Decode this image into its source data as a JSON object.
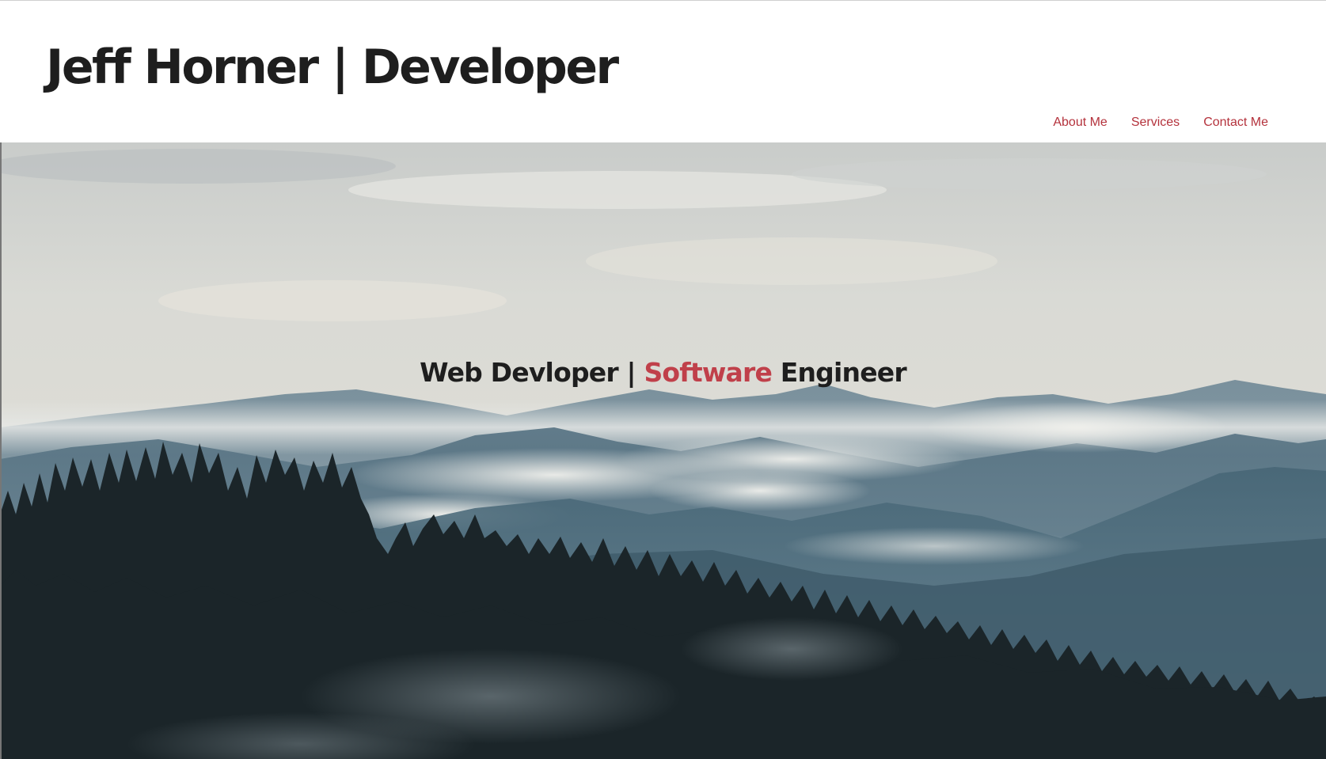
{
  "header": {
    "site_title": "Jeff Horner | Developer"
  },
  "nav": {
    "items": [
      {
        "label": "About Me"
      },
      {
        "label": "Services"
      },
      {
        "label": "Contact Me"
      }
    ]
  },
  "hero": {
    "tagline_part1": "Web Devloper | ",
    "tagline_accent": "Software",
    "tagline_part2": " Engineer",
    "background_description": "misty mountain ranges with pine forest silhouette"
  },
  "colors": {
    "accent": "#b4323c",
    "text": "#1e1e1e",
    "background": "#ffffff"
  }
}
